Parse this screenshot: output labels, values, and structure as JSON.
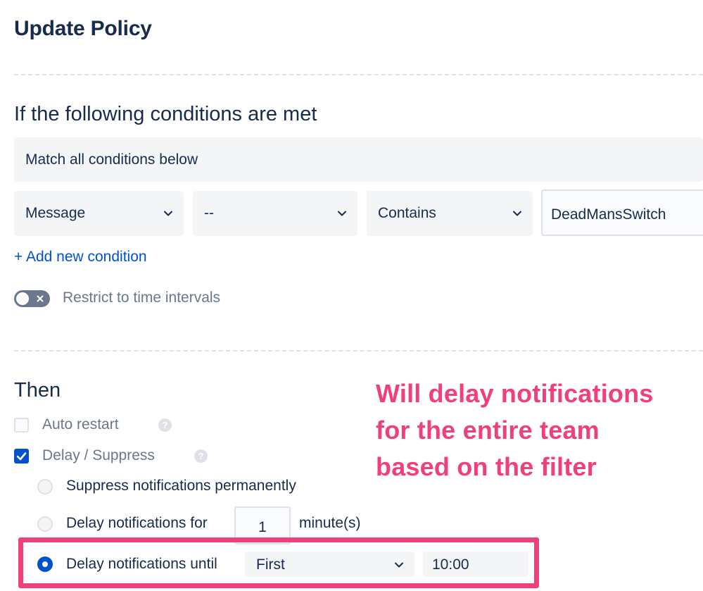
{
  "page": {
    "title": "Update Policy"
  },
  "conditions": {
    "heading": "If the following conditions are met",
    "match_mode": "Match all conditions below",
    "row": {
      "field": "Message",
      "negation": "--",
      "operator": "Contains",
      "value": "DeadMansSwitch"
    },
    "add_condition_label": "+ Add new condition",
    "restrict_time_label": "Restrict to time intervals",
    "restrict_time_enabled": false
  },
  "then": {
    "heading": "Then",
    "auto_restart_label": "Auto restart",
    "auto_restart_checked": false,
    "delay_suppress_label": "Delay / Suppress",
    "delay_suppress_checked": true,
    "options": {
      "suppress_label": "Suppress notifications permanently",
      "delay_for_label": "Delay notifications for",
      "delay_for_value": "1",
      "delay_for_unit": "minute(s)",
      "delay_until_label": "Delay notifications until",
      "delay_until_select": "First",
      "delay_until_time": "10:00",
      "selected": "delay_until"
    }
  },
  "annotation": {
    "line1": "Will delay notifications",
    "line2": "for the entire team",
    "line3": "based on the filter",
    "color": "#f0407a"
  },
  "colors": {
    "primary": "#0052cc",
    "text": "#172b4d",
    "subtle": "#6b778c"
  },
  "icons": {
    "chevron": "chevron-down-icon",
    "check": "check-icon",
    "help": "question-circle-icon",
    "toggle_off": "close-icon"
  },
  "help_glyph": "?"
}
